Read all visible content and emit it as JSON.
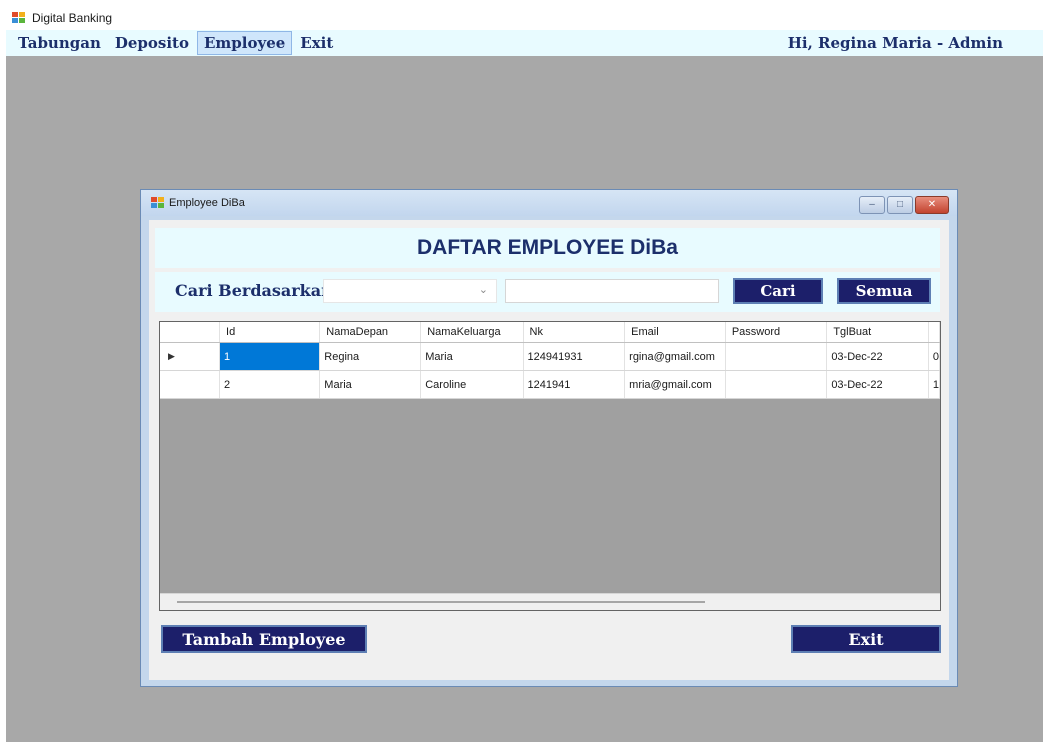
{
  "window": {
    "title": "Digital Banking"
  },
  "menu": {
    "items": [
      {
        "label": "Tabungan",
        "active": false
      },
      {
        "label": "Deposito",
        "active": false
      },
      {
        "label": "Employee",
        "active": true
      },
      {
        "label": "Exit",
        "active": false
      }
    ],
    "greeting": "Hi, Regina Maria - Admin"
  },
  "child": {
    "title": "Employee DiBa",
    "heading": "DAFTAR EMPLOYEE DiBa",
    "search": {
      "label": "Cari Berdasarkan",
      "combo_value": "",
      "text_value": "",
      "cari_label": "Cari",
      "semua_label": "Semua"
    },
    "grid": {
      "columns": [
        "Id",
        "NamaDepan",
        "NamaKeluarga",
        "Nk",
        "Email",
        "Password",
        "TglBuat"
      ],
      "rows": [
        {
          "marker": "▶",
          "cells": [
            "1",
            "Regina",
            "Maria",
            "124941931",
            "rgina@gmail.com",
            "",
            "03-Dec-22"
          ],
          "overflow": "0"
        },
        {
          "marker": "",
          "cells": [
            "2",
            "Maria",
            "Caroline",
            "1241941",
            "mria@gmail.com",
            "",
            "03-Dec-22"
          ],
          "overflow": "1"
        }
      ]
    },
    "tambah_label": "Tambah Employee",
    "exit_label": "Exit"
  },
  "colors": {
    "menu_bg": "#e8fbff",
    "mdi_bg": "#a8a8a8",
    "button_bg": "#1c1f6a",
    "selected_cell": "#0078d7"
  }
}
